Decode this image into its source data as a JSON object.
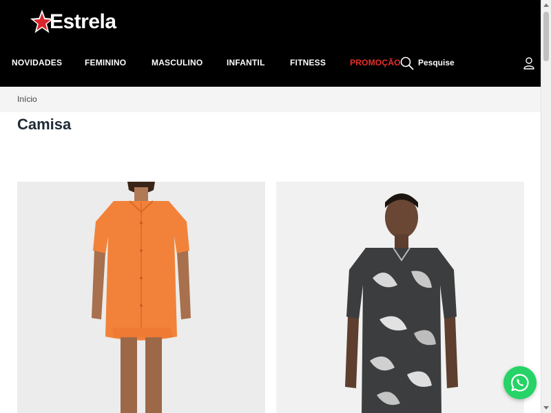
{
  "header": {
    "logo_text": "Estrela",
    "nav": [
      "NOVIDADES",
      "FEMININO",
      "MASCULINO",
      "INFANTIL",
      "FITNESS",
      "PROMOÇÃO"
    ],
    "search_label": "Pesquise",
    "icons": {
      "search": "search-icon",
      "user": "user-icon",
      "logo": "star-logo-icon"
    }
  },
  "breadcrumb": {
    "home": "Início"
  },
  "page": {
    "title": "Camisa"
  },
  "products": [
    {
      "image": "woman in orange short-sleeve shirt and shorts"
    },
    {
      "image": "man in black and white leaf print shirt"
    }
  ],
  "floating": {
    "whatsapp": "whatsapp-icon"
  },
  "colors": {
    "header_bg": "#000000",
    "promo": "#e8302a",
    "whatsapp": "#25d366",
    "title": "#1e2a36"
  }
}
